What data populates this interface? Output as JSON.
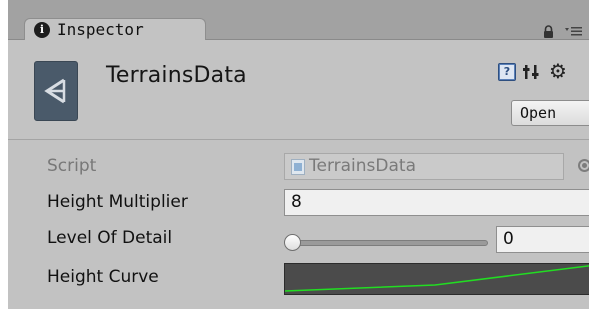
{
  "tab": {
    "label": "Inspector",
    "info_icon": "info-icon",
    "info_glyph": "i"
  },
  "header": {
    "title": "TerrainsData",
    "open_label": "Open",
    "help_glyph": "?",
    "gear_glyph": "⚙"
  },
  "fields": {
    "script": {
      "label": "Script",
      "value": "TerrainsData"
    },
    "height_multiplier": {
      "label": "Height Multiplier",
      "value": "8"
    },
    "level_of_detail": {
      "label": "Level Of Detail",
      "value": "0",
      "slider_fraction": 0
    },
    "height_curve": {
      "label": "Height Curve"
    }
  },
  "colors": {
    "curve_line": "#22dd22",
    "curve_background": "#4b4b4b",
    "panel_background": "#c2c2c2",
    "tabbar_background": "#a2a2a2"
  }
}
